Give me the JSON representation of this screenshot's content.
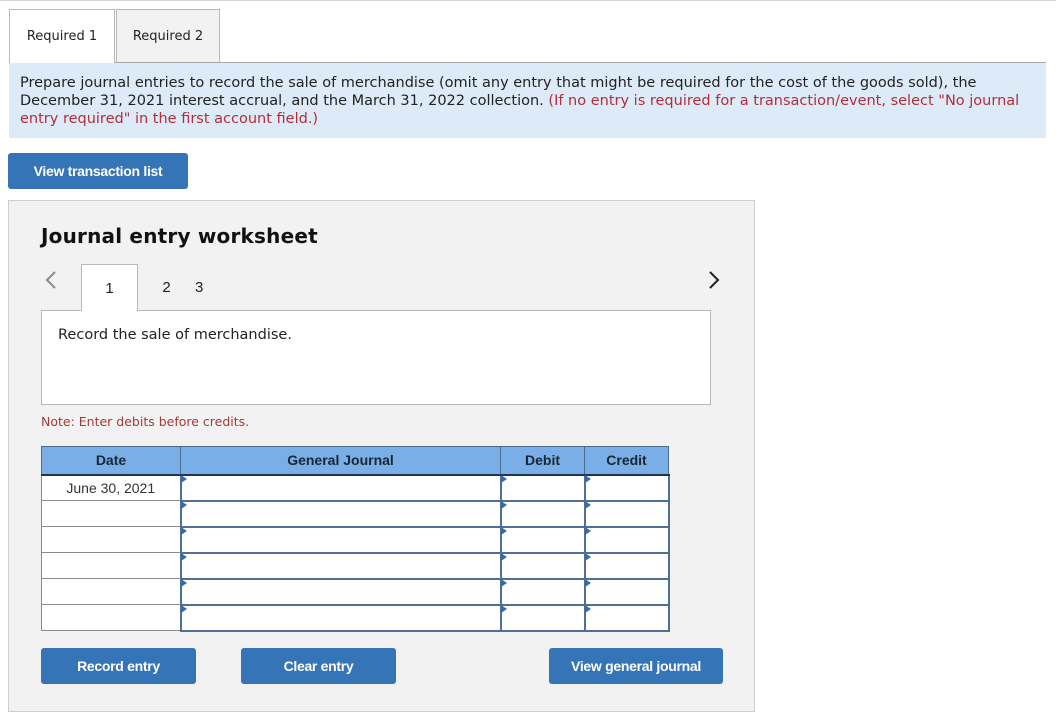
{
  "tabs": [
    {
      "label": "Required 1",
      "active": true
    },
    {
      "label": "Required 2",
      "active": false
    }
  ],
  "instructions": {
    "text": "Prepare journal entries to record the sale of merchandise (omit any entry that might be required for the cost of the goods sold), the December 31, 2021 interest accrual, and the March 31, 2022 collection. ",
    "note": "(If no entry is required for a transaction/event, select \"No journal entry required\" in the first account field.)"
  },
  "buttons": {
    "view_transaction_list": "View transaction list",
    "record_entry": "Record entry",
    "clear_entry": "Clear entry",
    "view_general_journal": "View general journal"
  },
  "worksheet": {
    "title": "Journal entry worksheet",
    "icons": {
      "prev": "chevron-left-icon",
      "next": "chevron-right-icon"
    },
    "steps": [
      "1",
      "2",
      "3"
    ],
    "active_step": "1",
    "description": "Record the sale of merchandise.",
    "note": "Note: Enter debits before credits."
  },
  "journal": {
    "headers": {
      "date": "Date",
      "account": "General Journal",
      "debit": "Debit",
      "credit": "Credit"
    },
    "rows": [
      {
        "date": "June 30, 2021",
        "account": "",
        "debit": "",
        "credit": ""
      },
      {
        "date": "",
        "account": "",
        "debit": "",
        "credit": ""
      },
      {
        "date": "",
        "account": "",
        "debit": "",
        "credit": ""
      },
      {
        "date": "",
        "account": "",
        "debit": "",
        "credit": ""
      },
      {
        "date": "",
        "account": "",
        "debit": "",
        "credit": ""
      },
      {
        "date": "",
        "account": "",
        "debit": "",
        "credit": ""
      }
    ]
  },
  "colors": {
    "accent_button": "#3674b8",
    "instructions_bg": "#dcebf7",
    "table_header": "#7aaee6",
    "note_red": "#b32d3a"
  }
}
